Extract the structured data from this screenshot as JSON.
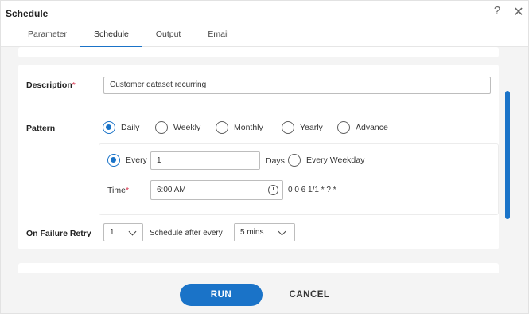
{
  "dialog": {
    "title": "Schedule",
    "help_glyph": "?",
    "close_glyph": "✕"
  },
  "tabs": [
    {
      "label": "Parameter",
      "active": false
    },
    {
      "label": "Schedule",
      "active": true
    },
    {
      "label": "Output",
      "active": false
    },
    {
      "label": "Email",
      "active": false
    }
  ],
  "form": {
    "description": {
      "label": "Description",
      "required_marker": "*",
      "value": "Customer dataset recurring"
    },
    "pattern": {
      "label": "Pattern",
      "options": [
        {
          "label": "Daily",
          "selected": true
        },
        {
          "label": "Weekly",
          "selected": false
        },
        {
          "label": "Monthly",
          "selected": false
        },
        {
          "label": "Yearly",
          "selected": false
        },
        {
          "label": "Advance",
          "selected": false
        }
      ]
    },
    "daily": {
      "every_label": "Every",
      "every_selected": true,
      "every_value": "1",
      "days_label": "Days",
      "every_weekday_label": "Every Weekday",
      "every_weekday_selected": false
    },
    "time": {
      "label": "Time",
      "required_marker": "*",
      "value": "6:00 AM",
      "cron": "0 0 6 1/1 * ? *"
    },
    "failure_retry": {
      "label": "On Failure Retry",
      "retry_value": "1",
      "schedule_after_label": "Schedule after every",
      "interval_value": "5 mins"
    }
  },
  "footer": {
    "run_label": "RUN",
    "cancel_label": "CANCEL"
  },
  "colors": {
    "accent": "#1a73c8",
    "required": "#d6304a",
    "background": "#f4f4f4"
  },
  "icons": {
    "help": "help-icon",
    "close": "close-icon",
    "time": "clock-icon",
    "dropdown": "chevron-down-icon"
  }
}
